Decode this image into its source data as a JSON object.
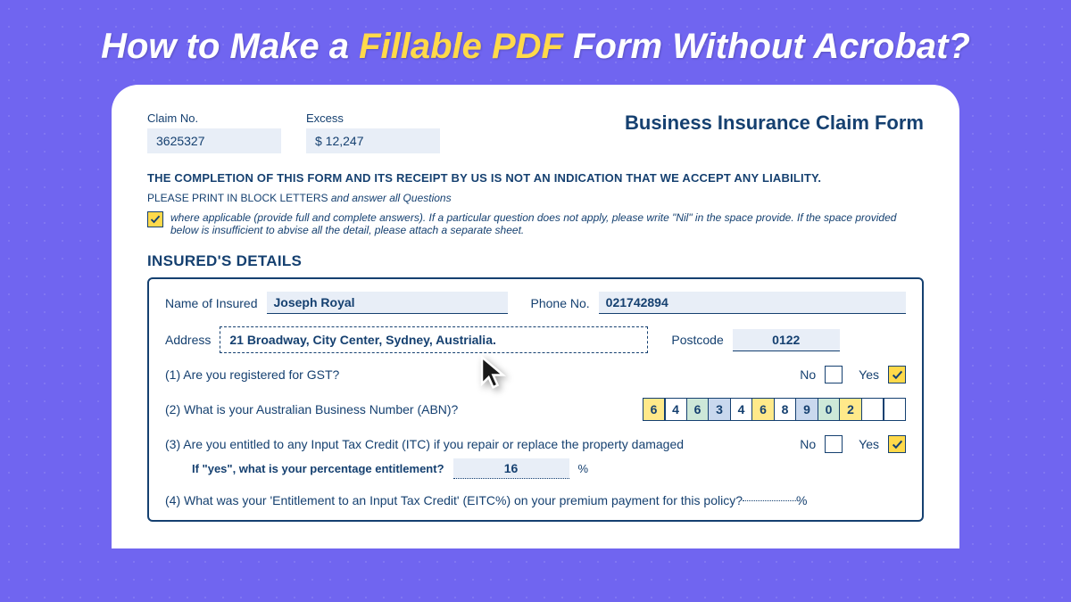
{
  "headline": {
    "part1": "How to Make a ",
    "highlight": "Fillable PDF",
    "part2": " Form Without Acrobat?"
  },
  "form": {
    "title": "Business Insurance Claim Form",
    "claim_no_label": "Claim No.",
    "claim_no_value": "3625327",
    "excess_label": "Excess",
    "excess_value": "$  12,247",
    "disclaimer": "THE COMPLETION OF THIS FORM AND ITS RECEIPT BY US IS NOT AN INDICATION THAT WE ACCEPT ANY LIABILITY.",
    "instruction_plain": "PLEASE PRINT IN BLOCK LETTERS ",
    "instruction_italic": "and answer all Questions",
    "check_instruction": "where applicable (provide full and complete answers). If a particular question does not apply, please write \"Nil\" in the space provide. If the space provided below is insufficient to abvise all the detail, please attach a separate sheet.",
    "section_title": "INSURED'S DETAILS",
    "name_label": "Name of Insured",
    "name_value": "Joseph Royal",
    "phone_label": "Phone No.",
    "phone_value": "021742894",
    "address_label": "Address",
    "address_value": "21 Broadway, City Center, Sydney, Austrialia.",
    "postcode_label": "Postcode",
    "postcode_value": "0122",
    "q1": "(1) Are you registered for GST?",
    "q2": "(2) What is your Australian Business Number (ABN)?",
    "q3": "(3) Are you entitled to any Input Tax Credit (ITC) if you repair or replace the property damaged",
    "q3_sub": "If \"yes\", what is your percentage entitlement?",
    "q3_sub_value": "16",
    "q4": "(4) What was your 'Entitlement to an Input Tax Credit' (EITC%) on your premium payment for this policy?",
    "no_label": "No",
    "yes_label": "Yes",
    "percent": "%",
    "abn": [
      "6",
      "4",
      "6",
      "3",
      "4",
      "6",
      "8",
      "9",
      "0",
      "2",
      "",
      ""
    ]
  }
}
